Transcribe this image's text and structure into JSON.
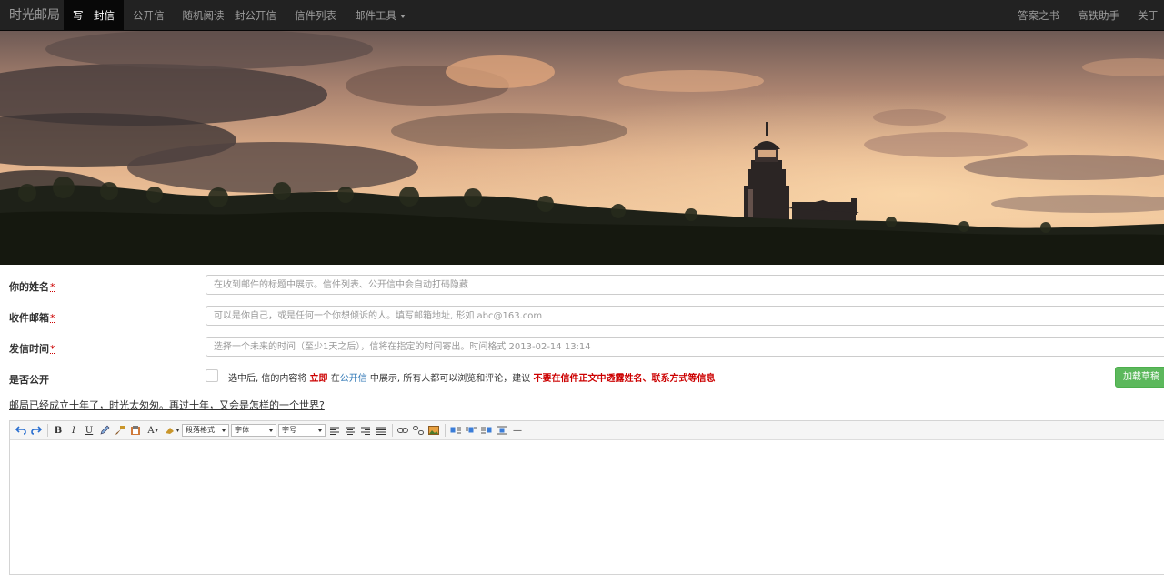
{
  "nav": {
    "brand": "时光邮局",
    "items": [
      {
        "label": "写一封信",
        "active": true
      },
      {
        "label": "公开信"
      },
      {
        "label": "随机阅读一封公开信"
      },
      {
        "label": "信件列表"
      },
      {
        "label": "邮件工具",
        "dropdown": true
      }
    ],
    "right_items": [
      {
        "label": "答案之书"
      },
      {
        "label": "高铁助手"
      },
      {
        "label": "关于"
      }
    ]
  },
  "form": {
    "name": {
      "label": "你的姓名",
      "required": "*",
      "placeholder": "在收到邮件的标题中展示。信件列表、公开信中会自动打码隐藏"
    },
    "email": {
      "label": "收件邮箱",
      "required": "*",
      "placeholder": "可以是你自己，或是任何一个你想倾诉的人。填写邮箱地址, 形如 abc@163.com"
    },
    "time": {
      "label": "发信时间",
      "required": "*",
      "placeholder": "选择一个未来的时间（至少1天之后），信将在指定的时间寄出。时间格式 2013-02-14 13:14"
    },
    "public": {
      "label": "是否公开",
      "note_1": "选中后, 信的内容将",
      "note_immediate": "立即",
      "note_2": "在",
      "note_link": "公开信",
      "note_3": "中展示, 所有人都可以浏览和评论，建议",
      "note_warning": "不要在信件正文中透露姓名、联系方式等信息"
    },
    "draft_button": "加载草稿",
    "tagline": "邮局已经成立十年了，时光太匆匆。再过十年，又会是怎样的一个世界?"
  },
  "editor": {
    "toolbar": {
      "undo_icon": "undo-icon",
      "redo_icon": "redo-icon",
      "bold": "B",
      "italic": "I",
      "underline": "U",
      "font_color": "A",
      "paragraph_format": "段落格式",
      "font_family": "字体",
      "font_size": "字号",
      "hr": "—"
    },
    "colors": {
      "toolbar_bg": "#f5f5f5",
      "accent_green": "#5cb85c",
      "warning_red": "#cc0000",
      "link_blue": "#337ab7"
    }
  },
  "colors": {
    "navbar_bg": "#222222",
    "navbar_active": "#080808"
  }
}
